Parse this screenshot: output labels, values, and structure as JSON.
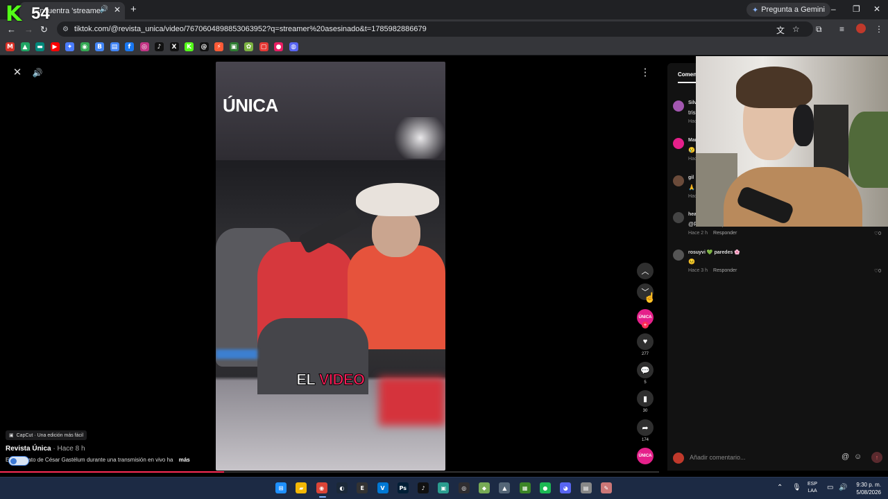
{
  "browser": {
    "kick_count": "54",
    "tab_title": "Encuentra 'streamer asesin",
    "new_tab": "+",
    "gemini_label": "Pregunta a Gemini",
    "url": "tiktok.com/@revista_unica/video/7670604898853063952?q=streamer%20asesinado&t=1785982886679",
    "bookmark_icons": [
      "gmail-icon",
      "drive-icon",
      "meet-icon",
      "youtube-icon",
      "gemini-icon",
      "maps-icon",
      "b-icon",
      "docs-icon",
      "facebook-icon",
      "instagram-icon",
      "tiktok-icon",
      "x-icon",
      "kick-icon",
      "threads-icon",
      "flash-icon",
      "app-icon",
      "game-icon",
      "red-app-icon",
      "pink-app-icon",
      "discord-app-icon"
    ]
  },
  "video": {
    "brand": "ÚNICA",
    "caption_white": "EL",
    "caption_red": "VIDEO",
    "capcut_label": "CapCut · Una edición más fácil",
    "author": "Revista Única",
    "posted": "· Hace 8 h",
    "description": "El asesinato de César Gastélum durante una transmisión en vivo ha",
    "more": "más",
    "progress": 0.34
  },
  "actions": {
    "avatar_label": "ÚNICA",
    "likes": "277",
    "comments": "5",
    "saves": "30",
    "shares": "174"
  },
  "comments": {
    "tab": "Comen",
    "items": [
      {
        "user": "Silv",
        "text": "tris",
        "meta": "Hac",
        "reply": "",
        "likes": "",
        "color": "#a357b0"
      },
      {
        "user": "Mar",
        "text": "😢",
        "meta": "Hac",
        "reply": "",
        "likes": "",
        "color": "#e5208a"
      },
      {
        "user": "gil",
        "text": "🙏",
        "meta": "Hac",
        "reply": "",
        "likes": "",
        "color": "#6b4b3a"
      },
      {
        "user": "hea",
        "text": "@Rèanne Dupris",
        "meta": "Hace 2 h",
        "reply": "Responder",
        "likes": "0",
        "color": "#444"
      },
      {
        "user": "rosuyvi 💚 paredes 🌸",
        "text": "😣",
        "meta": "Hace 3 h",
        "reply": "Responder",
        "likes": "0",
        "color": "#555"
      }
    ],
    "input_placeholder": "Añadir comentario..."
  },
  "taskbar": {
    "lang_line1": "ESP",
    "lang_line2": "LAA",
    "time": "9:30 p. m.",
    "date": "5/08/2026"
  }
}
